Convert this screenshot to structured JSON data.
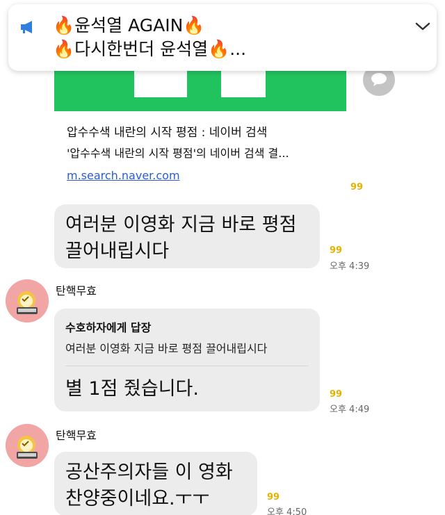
{
  "notice": {
    "line1": "🔥윤석열 AGAIN🔥",
    "line2": "🔥다시한번더 윤석열🔥...",
    "accent": "#2f7fe0"
  },
  "link_preview": {
    "title": "압수수색 내란의 시작 평점 : 네이버 검색",
    "description": "'압수수색 내란의 시작 평점'의 네이버 검색 결...",
    "url": "m.search.naver.com",
    "thumb_color": "#21c35e",
    "read_count": "99"
  },
  "messages": [
    {
      "text_lines": [
        "여러분 이영화 지금 바로 평점",
        "끌어내립시다"
      ],
      "read_count": "99",
      "time": "오후 4:39"
    },
    {
      "sender": "탄핵무효",
      "reply_to": "수호하자에게 답장",
      "quoted": "여러분 이영화 지금 바로 평점 끌어내립시다",
      "text": "별 1점 줬습니다.",
      "read_count": "99",
      "time": "오후 4:49"
    },
    {
      "sender": "탄핵무효",
      "text_lines": [
        "공산주의자들 이 영화",
        "찬양중이네요.ㅜㅜ"
      ],
      "read_count": "99",
      "time": "오후 4:50"
    }
  ],
  "colors": {
    "bubble": "#ececec",
    "read_count": "#e2b400",
    "link": "#2a5bd7"
  }
}
